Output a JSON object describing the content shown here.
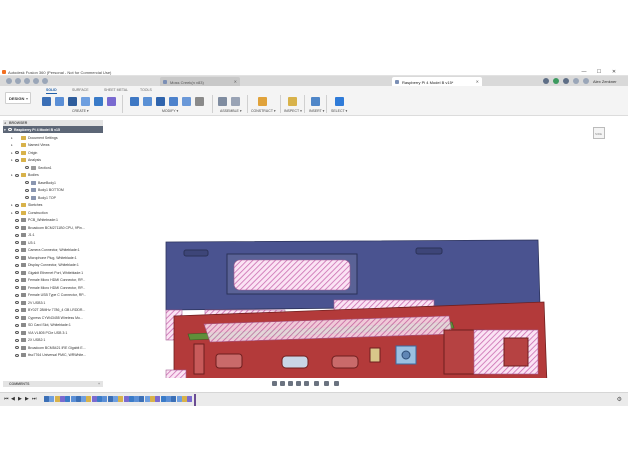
{
  "window": {
    "title": "Autodesk Fusion 360 (Personal - Not for Commercial Use)",
    "minimize": "—",
    "maximize": "☐",
    "close": "✕"
  },
  "tabs": [
    {
      "label": "Moss Creek(n v83)",
      "active": false
    },
    {
      "label": "Raspberry Pi 4 Model B v15*",
      "active": true
    }
  ],
  "user": {
    "name": "Alex Zenkner"
  },
  "toolbar": {
    "workspace": "DESIGN",
    "tabs": [
      "SOLID",
      "SURFACE",
      "SHEET METAL",
      "TOOLS"
    ],
    "active_tab": "SOLID",
    "groups": [
      "CREATE ▾",
      "MODIFY ▾",
      "ASSEMBLE ▾",
      "CONSTRUCT ▾",
      "INSPECT ▾",
      "INSERT ▾",
      "SELECT ▾"
    ]
  },
  "browser": {
    "title": "BROWSER",
    "root": "Raspberry Pi 4 Model B v15",
    "items": [
      "Document Settings",
      "Named Views",
      "Origin",
      "Analysis",
      "Section1",
      "Bodies",
      "BaseBody1",
      "Body1 BOTTOM",
      "Body1 TOP",
      "Sketches",
      "Construction",
      "PCB_Whitebrade:1",
      "Broadcom BCM2711B0 CPU, 9Pin...",
      "J1:1",
      "U3:1",
      "Camera Connector, Whiteblade:1",
      "Microphone Plug, Whiteblade:1",
      "Display Connector, Whiteblade:1",
      "Gigabit Ethernet Port, Whiteblade:1",
      "Female Micro HDMI Connector, RP...",
      "Female Micro HDMI Connector, RP...",
      "Female USB Type C Connector, RP...",
      "2V USB3:1",
      "BY02T 28MHz 7786_4 GB LRDDR...",
      "Cypress CYW43455 Wireless Mo...",
      "SD Card Slot, Whiteblade:1",
      "VIA VL805 PCIe USB 3:1",
      "2X USB2:1",
      "Broadcom BCM5421 IRE Gigabit E...",
      "ttsc7764 Universal PMIC, WRWhite..."
    ]
  },
  "comments": {
    "label": "COMMENTS",
    "add": "+"
  },
  "viewcube": {
    "label": "SIDE"
  },
  "colors": {
    "accent": "#1f5ea8",
    "case_top": "#4a5390",
    "case_bottom": "#b33a3a",
    "section_hatch": "#e6a8d4",
    "pcb_green": "#5f8f3a",
    "timeline_marker": "#6a4c93"
  },
  "icons": {
    "timeline_controls": [
      "skip-back-icon",
      "step-back-icon",
      "play-icon",
      "step-forward-icon",
      "skip-forward-icon"
    ],
    "settings": "gear-icon"
  }
}
